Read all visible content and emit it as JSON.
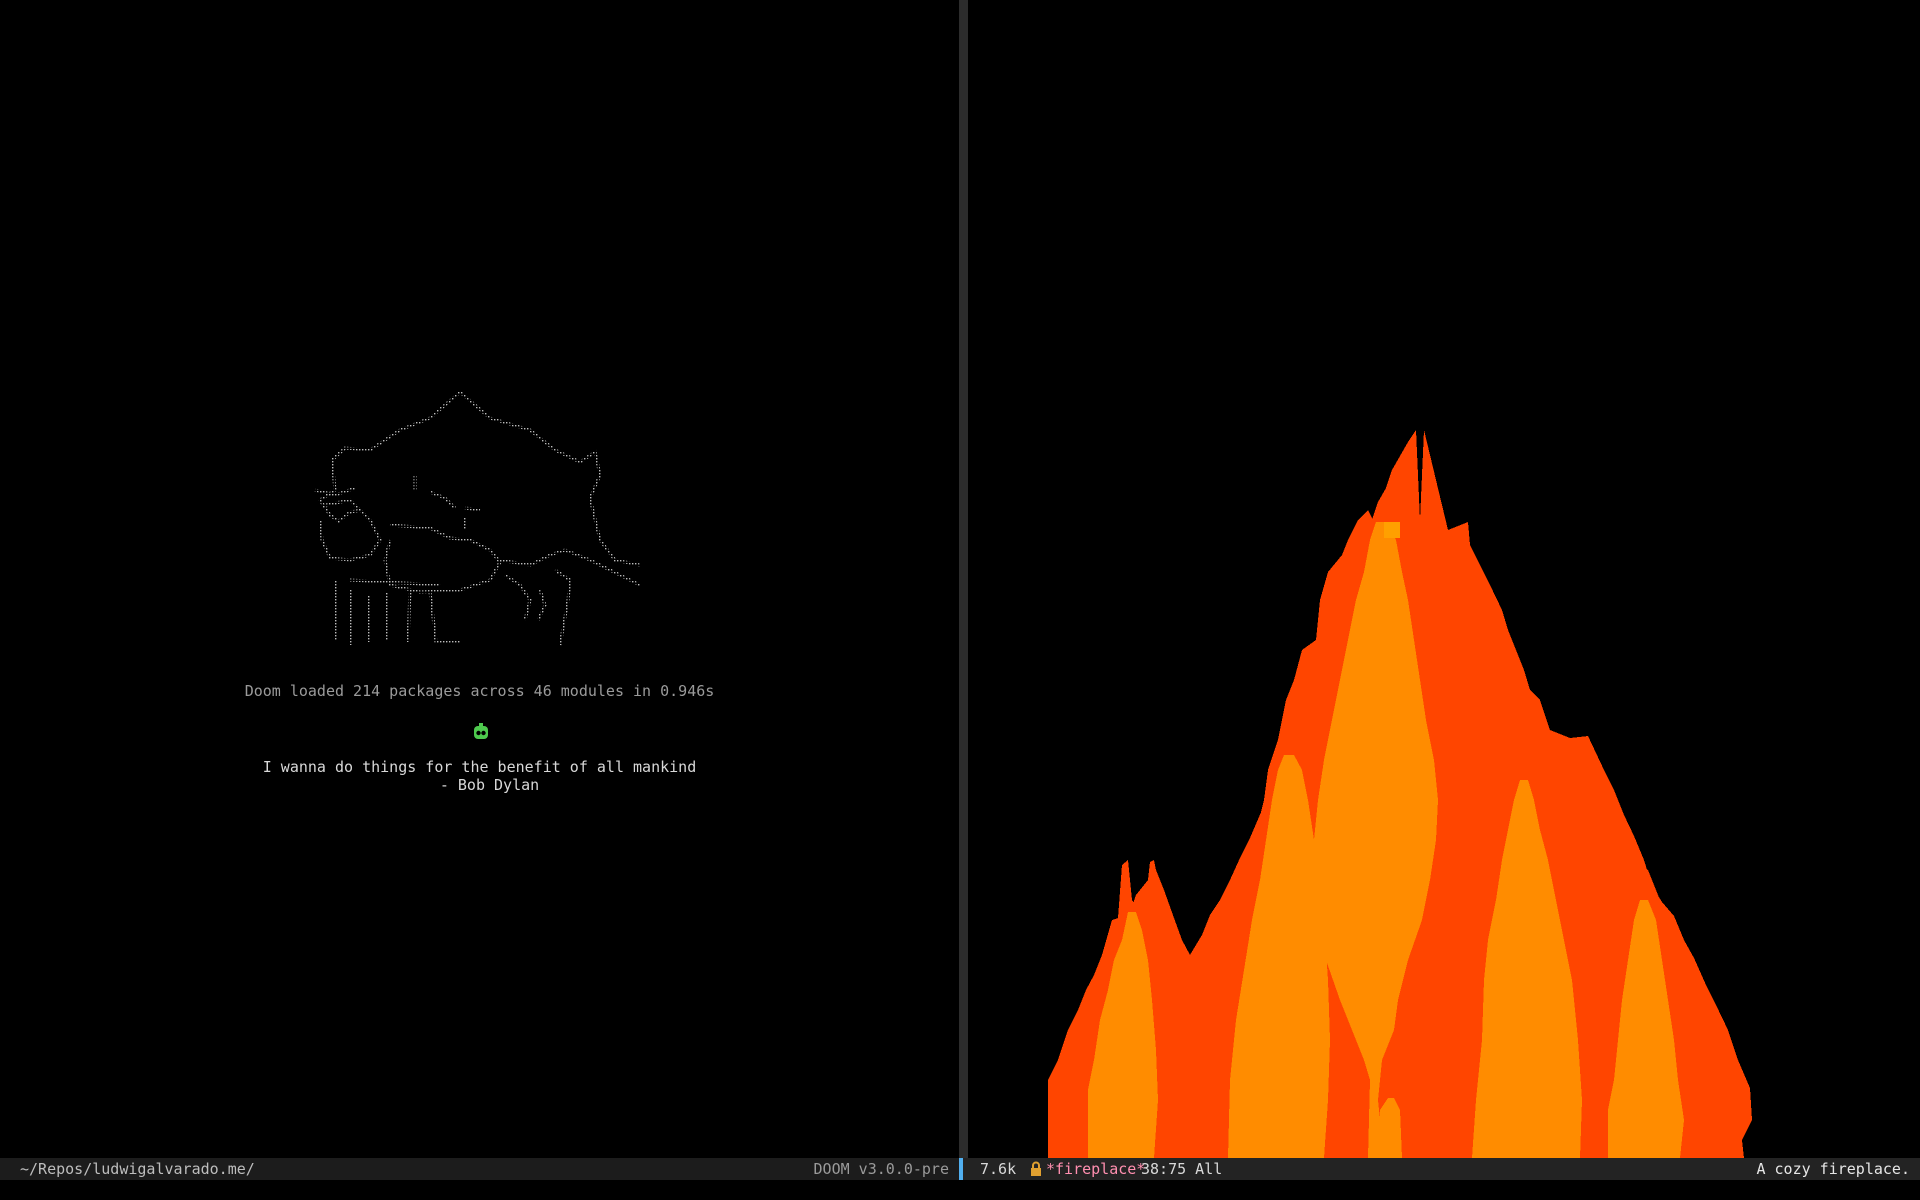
{
  "splash": {
    "load_message": "Doom loaded 214 packages across 46 modules in 0.946s",
    "quote_line1": "I wanna do things for the benefit of all mankind",
    "quote_line2": "- Bob Dylan",
    "art_icon": "cat-dotted-ascii-art",
    "bot_icon": "green-robot-icon"
  },
  "modeline_left": {
    "path": "~/Repos/ludwigalvarado.me/",
    "doom_version": "DOOM v3.0.0-pre"
  },
  "modeline_right": {
    "size": "7.6k",
    "lock_icon": "lock-icon",
    "buffer_name": "*fireplace*",
    "position": "38:75 All",
    "message": "A cozy fireplace."
  },
  "colors": {
    "background": "#000000",
    "fire_outer": "#ff4500",
    "fire_inner": "#ff8c00",
    "fire_core": "#ffa000",
    "accent": "#51afef",
    "buffer_name": "#ff8fb0",
    "bot": "#4ec94e"
  }
}
